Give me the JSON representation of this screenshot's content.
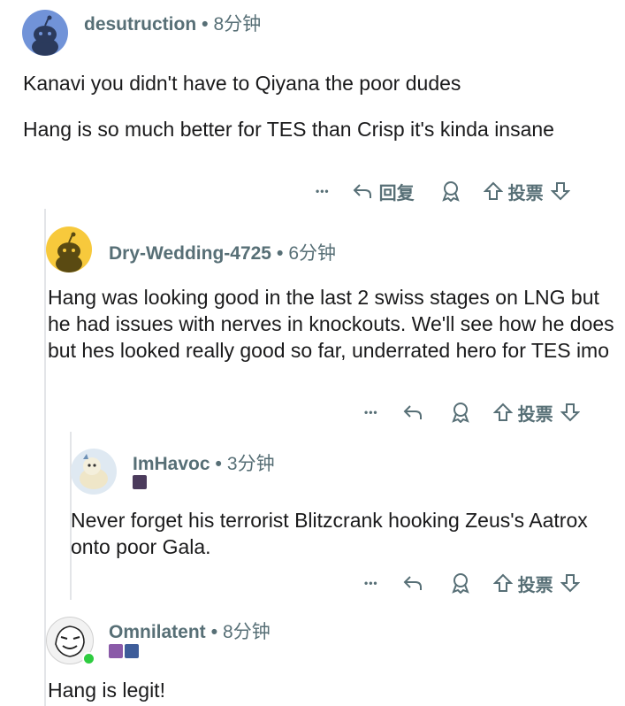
{
  "comments": [
    {
      "username": "desutruction",
      "separator": "•",
      "time": "8分钟",
      "paragraphs": [
        "Kanavi you didn't have to Qiyana the poor dudes",
        "Hang is so much better for TES than Crisp it's kinda insane"
      ],
      "actions": {
        "more": "•••",
        "reply": "回复",
        "vote": "投票"
      }
    },
    {
      "username": "Dry-Wedding-4725",
      "separator": "•",
      "time": "6分钟",
      "paragraphs": [
        "Hang was looking good in the last 2 swiss stages on LNG but he had issues with nerves in knockouts. We'll see how he does but hes looked really good so far, underrated hero for TES imo"
      ],
      "actions": {
        "more": "•••",
        "vote": "投票"
      }
    },
    {
      "username": "ImHavoc",
      "separator": "•",
      "time": "3分钟",
      "paragraphs": [
        "Never forget his terrorist Blitzcrank hooking Zeus's Aatrox onto poor Gala."
      ],
      "actions": {
        "more": "•••",
        "vote": "投票"
      }
    },
    {
      "username": "Omnilatent",
      "separator": "•",
      "time": "8分钟",
      "paragraphs": [
        "Hang is legit!"
      ]
    }
  ],
  "colors": {
    "username": "#576f76",
    "text": "#1a1a1b",
    "thread_line": "#e3e5e8",
    "online": "#2ecc40",
    "avatar_blue": "#7193d8",
    "avatar_yellow": "#f7c93c"
  }
}
